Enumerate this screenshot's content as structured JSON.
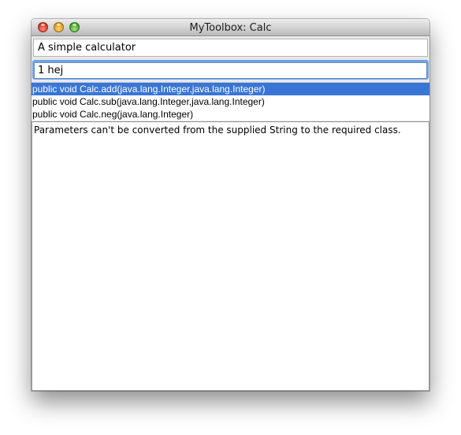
{
  "window": {
    "title": "MyToolbox: Calc"
  },
  "description": "A simple calculator",
  "input": {
    "value": "1 hej"
  },
  "methods": [
    {
      "label": "public void Calc.add(java.lang.Integer,java.lang.Integer)",
      "selected": true
    },
    {
      "label": "public void Calc.sub(java.lang.Integer,java.lang.Integer)",
      "selected": false
    },
    {
      "label": "public void Calc.neg(java.lang.Integer)",
      "selected": false
    }
  ],
  "output": {
    "text": "Parameters can't be converted from the supplied String to the required class."
  },
  "colors": {
    "selection": "#3875d7",
    "focus_ring": "#6fa3e6",
    "close": "#d3301c",
    "minimize": "#d99a13",
    "maximize": "#3f9f1f"
  }
}
